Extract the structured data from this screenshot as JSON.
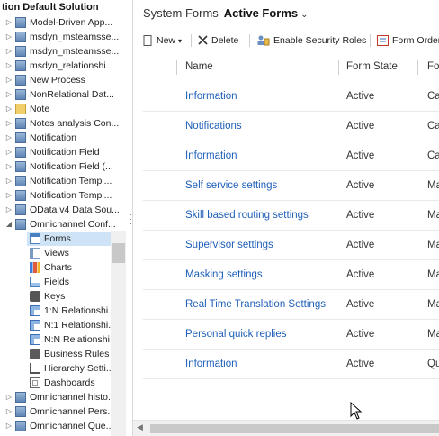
{
  "solution_title": "tion Default Solution",
  "tree": {
    "items": [
      {
        "label": "Model-Driven App...",
        "icon": "entity-icon"
      },
      {
        "label": "msdyn_msteamsse...",
        "icon": "entity-icon"
      },
      {
        "label": "msdyn_msteamsse...",
        "icon": "entity-icon"
      },
      {
        "label": "msdyn_relationshi...",
        "icon": "entity-icon"
      },
      {
        "label": "New Process",
        "icon": "entity-icon"
      },
      {
        "label": "NonRelational Dat...",
        "icon": "entity-icon"
      },
      {
        "label": "Note",
        "icon": "entity-icon"
      },
      {
        "label": "Notes analysis Con...",
        "icon": "entity-icon"
      },
      {
        "label": "Notification",
        "icon": "entity-icon"
      },
      {
        "label": "Notification Field",
        "icon": "entity-icon"
      },
      {
        "label": "Notification Field (...",
        "icon": "entity-icon"
      },
      {
        "label": "Notification Templ...",
        "icon": "entity-icon"
      },
      {
        "label": "Notification Templ...",
        "icon": "entity-icon"
      },
      {
        "label": "OData v4 Data Sou...",
        "icon": "entity-icon"
      },
      {
        "label": "Omnichannel Conf...",
        "icon": "entity-icon"
      }
    ],
    "children": [
      {
        "label": "Forms",
        "icon": "forms-icon"
      },
      {
        "label": "Views",
        "icon": "views-icon"
      },
      {
        "label": "Charts",
        "icon": "charts-icon"
      },
      {
        "label": "Fields",
        "icon": "fields-icon"
      },
      {
        "label": "Keys",
        "icon": "keys-icon"
      },
      {
        "label": "1:N Relationshi...",
        "icon": "relationship-icon"
      },
      {
        "label": "N:1 Relationshi...",
        "icon": "relationship-icon"
      },
      {
        "label": "N:N Relationshi...",
        "icon": "relationship-icon"
      },
      {
        "label": "Business Rules",
        "icon": "business-rules-icon"
      },
      {
        "label": "Hierarchy Setti...",
        "icon": "hierarchy-icon"
      },
      {
        "label": "Dashboards",
        "icon": "dashboards-icon"
      }
    ],
    "trailing": [
      {
        "label": "Omnichannel histo...",
        "icon": "entity-icon"
      },
      {
        "label": "Omnichannel Pers...",
        "icon": "entity-icon"
      },
      {
        "label": "Omnichannel Que...",
        "icon": "entity-icon"
      }
    ]
  },
  "breadcrumb": {
    "system": "System Forms",
    "active": "Active Forms",
    "chevron": "⌄"
  },
  "toolbar": {
    "new_label": "New",
    "delete_label": "Delete",
    "security_label": "Enable Security Roles",
    "order_label": "Form Order"
  },
  "grid": {
    "columns": {
      "name": "Name",
      "state": "Form State",
      "type": "Fo"
    },
    "rows": [
      {
        "name": "Information",
        "state": "Active",
        "type": "Ca"
      },
      {
        "name": "Notifications",
        "state": "Active",
        "type": "Ca"
      },
      {
        "name": "Information",
        "state": "Active",
        "type": "Ca"
      },
      {
        "name": "Self service settings",
        "state": "Active",
        "type": "Ma"
      },
      {
        "name": "Skill based routing settings",
        "state": "Active",
        "type": "Ma"
      },
      {
        "name": "Supervisor settings",
        "state": "Active",
        "type": "Ma"
      },
      {
        "name": "Masking settings",
        "state": "Active",
        "type": "Ma"
      },
      {
        "name": "Real Time Translation Settings",
        "state": "Active",
        "type": "Ma"
      },
      {
        "name": "Personal quick replies",
        "state": "Active",
        "type": "Ma"
      },
      {
        "name": "Information",
        "state": "Active",
        "type": "Qu"
      }
    ]
  },
  "colors": {
    "link": "#1d5fb8",
    "selected": "#cfe3f7"
  }
}
